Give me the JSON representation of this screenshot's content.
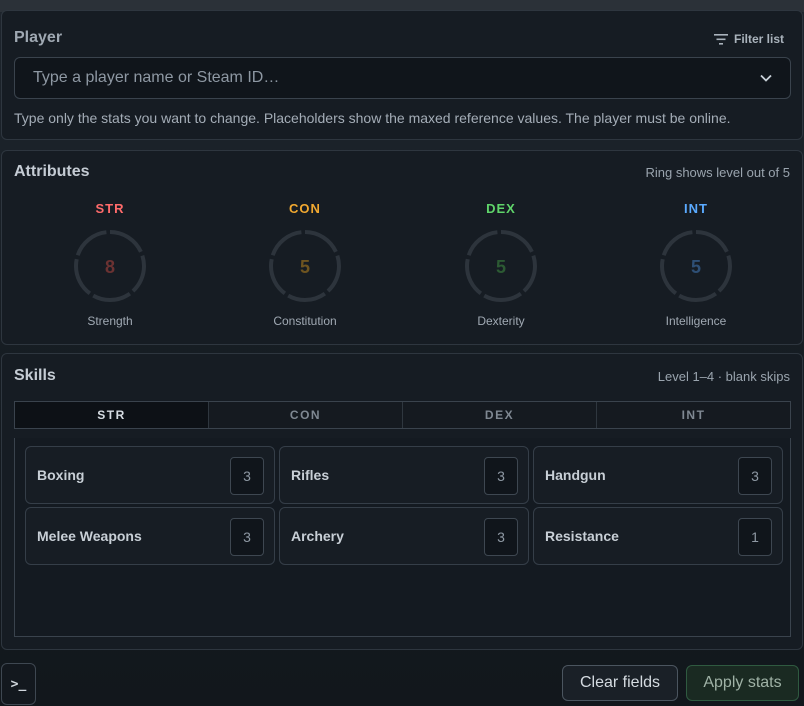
{
  "player": {
    "title": "Player",
    "filter_label": "Filter list",
    "select_placeholder": "Type a player name or Steam ID…",
    "hint": "Type only the stats you want to change. Placeholders show the maxed reference values. The player must be online."
  },
  "attributes": {
    "title": "Attributes",
    "meta": "Ring shows level out of 5",
    "max_level": 5,
    "items": [
      {
        "abbr": "STR",
        "name": "Strength",
        "value": "8",
        "color": "#ff6b6b",
        "value_color": "#6b3232"
      },
      {
        "abbr": "CON",
        "name": "Constitution",
        "value": "5",
        "color": "#f0a830",
        "value_color": "#6e5420"
      },
      {
        "abbr": "DEX",
        "name": "Dexterity",
        "value": "5",
        "color": "#5fd46a",
        "value_color": "#2c5a33"
      },
      {
        "abbr": "INT",
        "name": "Intelligence",
        "value": "5",
        "color": "#5aaaff",
        "value_color": "#2e4f75"
      }
    ]
  },
  "skills": {
    "title": "Skills",
    "meta": "Level 1–4 · blank skips",
    "tabs": [
      "STR",
      "CON",
      "DEX",
      "INT"
    ],
    "active_tab": "STR",
    "items": [
      {
        "name": "Boxing",
        "value": "3"
      },
      {
        "name": "Rifles",
        "value": "3"
      },
      {
        "name": "Handgun",
        "value": "3"
      },
      {
        "name": "Melee Weapons",
        "value": "3"
      },
      {
        "name": "Archery",
        "value": "3"
      },
      {
        "name": "Resistance",
        "value": "1"
      }
    ]
  },
  "footer": {
    "console_label": ">_",
    "clear_label": "Clear fields",
    "apply_label": "Apply stats"
  }
}
